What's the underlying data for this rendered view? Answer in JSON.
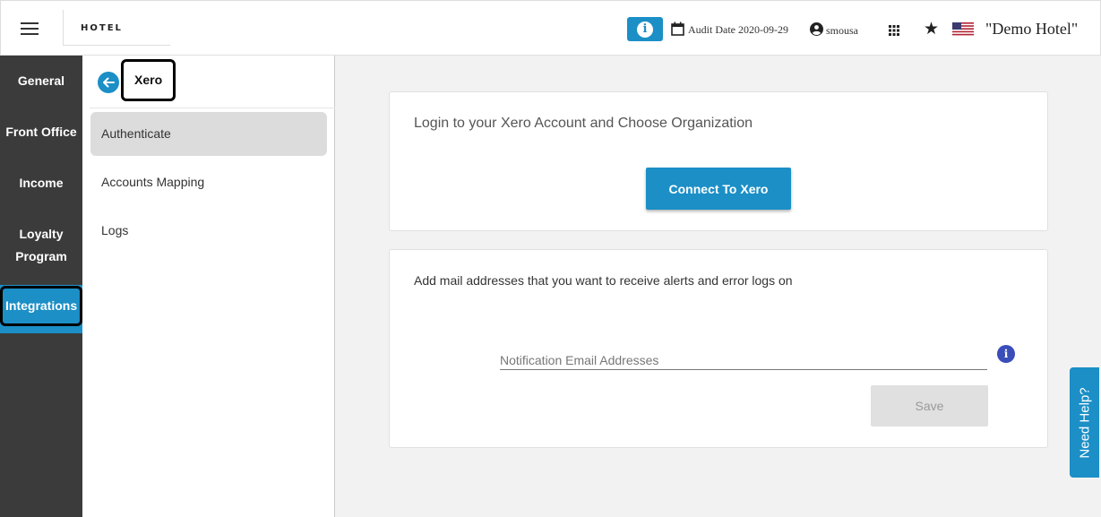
{
  "header": {
    "logo_text": "HOTEL",
    "audit_date": "Audit Date 2020-09-29",
    "username": "smousa",
    "hotel_name": "\"Demo Hotel\"",
    "info_label": "i"
  },
  "left_nav": {
    "items": [
      {
        "label": "General"
      },
      {
        "label": "Front Office"
      },
      {
        "label": "Income"
      },
      {
        "label": "Loyalty Program"
      },
      {
        "label": "Integrations"
      }
    ],
    "active": "Integrations"
  },
  "sub_nav": {
    "title": "Xero",
    "items": [
      {
        "label": "Authenticate"
      },
      {
        "label": "Accounts Mapping"
      },
      {
        "label": "Logs"
      }
    ],
    "active": "Authenticate"
  },
  "auth_card": {
    "heading": "Login to your Xero Account and Choose Organization",
    "connect_label": "Connect To Xero"
  },
  "email_card": {
    "heading": "Add mail addresses that you want to receive alerts and error logs on",
    "input_placeholder": "Notification Email Addresses",
    "input_value": "",
    "info_label": "i",
    "save_label": "Save"
  },
  "help": {
    "label": "Need Help?"
  },
  "colors": {
    "accent": "#1b8fc6",
    "nav_bg": "#3b3b3b",
    "info_purple": "#3b4db8"
  }
}
